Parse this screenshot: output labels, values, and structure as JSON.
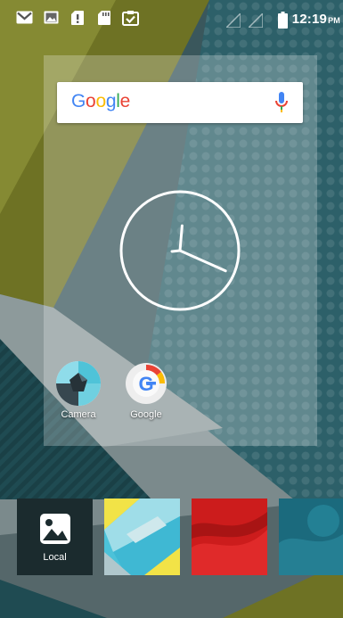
{
  "status_bar": {
    "time": "12:19",
    "ampm": "PM",
    "icons": [
      "gmail-icon",
      "gallery-icon",
      "alert-icon",
      "sd-card-icon",
      "clipboard-check-icon",
      "signal-icon",
      "signal-icon",
      "battery-icon"
    ]
  },
  "search": {
    "logo_letters": [
      "G",
      "o",
      "o",
      "g",
      "l",
      "e"
    ],
    "logo_colors": [
      "#4285F4",
      "#EA4335",
      "#FBBC05",
      "#4285F4",
      "#34A853",
      "#EA4335"
    ]
  },
  "clock": {
    "hour_hand_angle_deg": 5,
    "minute_hand_angle_deg": 114
  },
  "apps": [
    {
      "label": "Camera",
      "icon": "camera-aperture-icon"
    },
    {
      "label": "Google",
      "icon": "google-app-icon"
    }
  ],
  "wallpaper_picker": {
    "local_label": "Local",
    "thumbnails": [
      "local-gallery-tile",
      "geometric-wallpaper",
      "red-wallpaper",
      "teal-wallpaper"
    ]
  },
  "colors": {
    "olive": "#6d7123",
    "teal_dark": "#1f4f57",
    "status_text": "#ffffff"
  }
}
